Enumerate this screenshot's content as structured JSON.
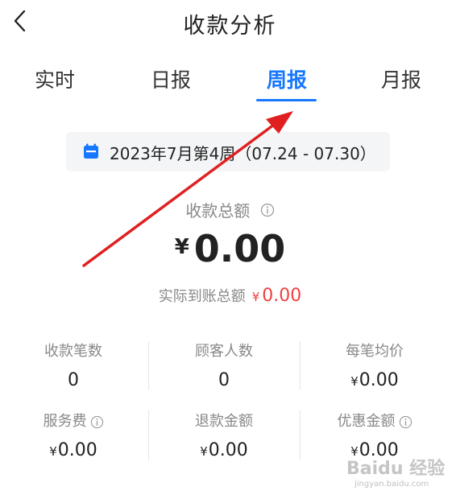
{
  "header": {
    "title": "收款分析"
  },
  "tabs": [
    {
      "label": "实时",
      "active": false
    },
    {
      "label": "日报",
      "active": false
    },
    {
      "label": "周报",
      "active": true
    },
    {
      "label": "月报",
      "active": false
    }
  ],
  "date_picker": {
    "text": "2023年7月第4周（07.24 - 07.30）"
  },
  "summary": {
    "total_label": "收款总额",
    "currency": "¥",
    "total_amount": "0.00",
    "actual_label": "实际到账总额",
    "actual_amount": "0.00"
  },
  "stats": [
    {
      "label": "收款笔数",
      "value": "0"
    },
    {
      "label": "顾客人数",
      "value": "0"
    },
    {
      "label": "每笔均价",
      "currency": "¥",
      "value": "0.00"
    },
    {
      "label": "服务费",
      "currency": "¥",
      "value": "0.00"
    },
    {
      "label": "退款金额",
      "currency": "¥",
      "value": "0.00"
    },
    {
      "label": "优惠金额",
      "currency": "¥",
      "value": "0.00"
    }
  ],
  "watermark": {
    "brand": "Baidu 经验",
    "url": "jingyan.baidu.com"
  },
  "colors": {
    "accent": "#1677ff",
    "negative": "#f04040",
    "annotation_arrow": "#e02020"
  }
}
